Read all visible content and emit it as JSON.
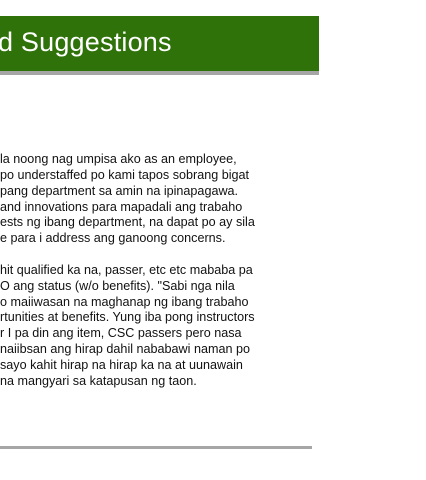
{
  "header": {
    "title": "d Suggestions"
  },
  "paragraphs": [
    {
      "lines": [
        "la noong nag umpisa ako as an employee,",
        "po understaffed po kami tapos sobrang bigat",
        "pang department sa amin na ipinapagawa.",
        "and innovations para mapadali ang trabaho",
        "ests ng ibang department, na dapat po ay sila",
        "e para i address ang ganoong concerns."
      ]
    },
    {
      "lines": [
        "hit qualified ka na, passer, etc etc mababa pa",
        "O ang status (w/o benefits). \"Sabi nga nila",
        "o maiiwasan na maghanap ng ibang trabaho",
        "rtunities at benefits. Yung iba pong instructors",
        "r I pa din ang item, CSC passers pero nasa",
        "naiibsan ang hirap dahil nababawi naman po",
        "sayo kahit hirap na hirap ka na at uunawain",
        "na mangyari sa katapusan ng taon."
      ]
    }
  ],
  "colors": {
    "header_background": "#2f7209",
    "header_text": "#ffffff",
    "rule": "#a6a6a6",
    "body_text": "#111111"
  }
}
